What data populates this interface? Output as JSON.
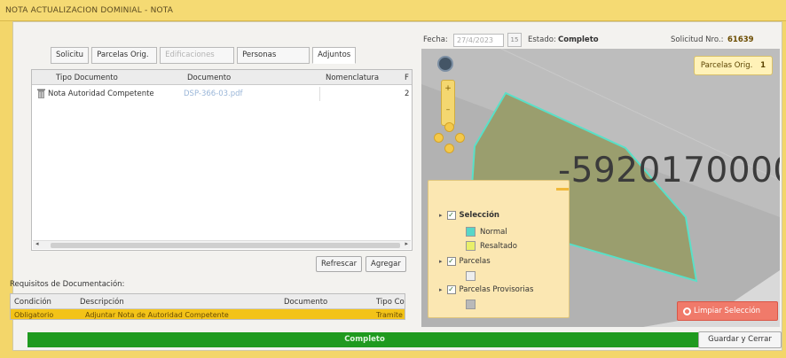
{
  "window": {
    "title": "NOTA ACTUALIZACION DOMINIAL  -  NOTA"
  },
  "tabs": [
    {
      "label": "Solicitu",
      "state": "normal"
    },
    {
      "label": "Parcelas Orig.",
      "state": "normal"
    },
    {
      "label": "Edificaciones",
      "state": "disabled"
    },
    {
      "label": "Personas",
      "state": "normal"
    },
    {
      "label": "Adjuntos",
      "state": "active"
    }
  ],
  "adjuntos_grid": {
    "columns": [
      "Tipo Documento",
      "Documento",
      "Nomenclatura",
      "F"
    ],
    "rows": [
      {
        "tipo": "Nota Autoridad Competente",
        "documento": "DSP-366-03.pdf",
        "nomenclatura": "",
        "f": "2"
      }
    ]
  },
  "buttons": {
    "refresh": "Refrescar",
    "add": "Agregar",
    "clear_selection": "Limpiar Selección",
    "save_close": "Guardar y Cerrar"
  },
  "requisitos": {
    "label": "Requisitos de Documentación:",
    "columns": [
      "Condición",
      "Descripción",
      "Documento",
      "Tipo Co"
    ],
    "rows": [
      {
        "condicion": "Obligatorio",
        "descripcion": "Adjuntar Nota de Autoridad Competente",
        "documento": "",
        "tipo": "Tramite El"
      }
    ]
  },
  "header": {
    "fecha_label": "Fecha:",
    "fecha_value": "27/4/2023",
    "estado_label": "Estado:",
    "estado_value": "Completo",
    "solicitud_label": "Solicitud Nro.:",
    "solicitud_value": "61639"
  },
  "map": {
    "parcel_number": "-5920170000",
    "origin_dropdown": "Parcelas Orig.",
    "origin_count": "1",
    "layers": [
      {
        "label": "Selección",
        "checked": true,
        "bold": true
      },
      {
        "label": "Parcelas",
        "checked": true,
        "bold": false
      },
      {
        "label": "Parcelas Provisorias",
        "checked": true,
        "bold": false
      }
    ],
    "legend": [
      {
        "label": "Normal",
        "color": "#58d6c8"
      },
      {
        "label": "Resaltado",
        "color": "#e9ef6a"
      }
    ]
  },
  "status_bar": {
    "text": "Completo",
    "color": "#1f9a1f"
  },
  "colors": {
    "accent_yellow": "#f3d66a",
    "parcel_fill": "#9a9e6e",
    "parcel_stroke": "#59e0c8",
    "clear_button": "#f07a6a"
  }
}
